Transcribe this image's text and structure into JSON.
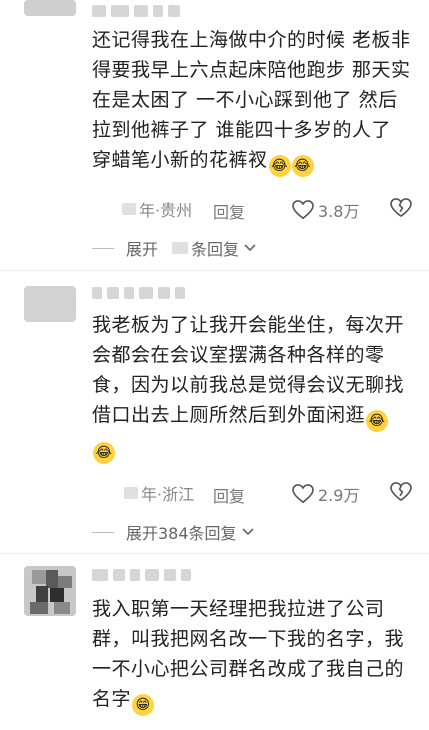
{
  "comments": [
    {
      "content": "还记得我在上海做中介的时候 老板非得要我早上六点起床陪他跑步 那天实在是太困了 一不小心踩到他了 然后拉到他裤子了 谁能四十多岁的人了 穿蜡笔小新的花裤衩",
      "emoji": [
        "😂",
        "😂"
      ],
      "meta_suffix": "年·贵州",
      "reply_label": "回复",
      "likes": "3.8万",
      "expand_label": "展开",
      "expand_suffix": "条回复"
    },
    {
      "content": "我老板为了让我开会能坐住，每次开会都会在会议室摆满各种各样的零食，因为以前我总是觉得会议无聊找借口出去上厕所然后到外面闲逛",
      "emoji": [
        "😂",
        "😂"
      ],
      "meta_suffix": "年·浙江",
      "reply_label": "回复",
      "likes": "2.9万",
      "expand_label": "展开384条回复"
    },
    {
      "content": "我入职第一天经理把我拉进了公司群，叫我把网名改一下我的名字，我一不小心把公司群名改成了我自己的名字",
      "emoji": [
        "😁"
      ]
    }
  ],
  "colors": {
    "text": "#222222",
    "meta": "#888888",
    "emoji": "#ffd23f"
  }
}
